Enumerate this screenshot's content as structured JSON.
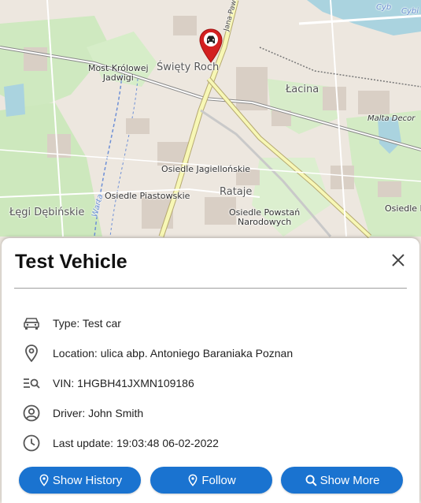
{
  "map": {
    "labels": {
      "most": "Most Królowej\nJadwigi",
      "swiety": "Święty Roch",
      "lacina": "Łacina",
      "malta": "Malta Decor",
      "jagiellonskie": "Osiedle Jagiellońskie",
      "piastowskie": "Osiedle Piastowskie",
      "rataje": "Rataje",
      "powstan": "Osiedle Powstań\nNarodowych",
      "legi": "Łęgi Dębińskie",
      "lech": "Osiedle L",
      "warta": "Warta",
      "jana": "Jana Pawła",
      "cyb": "Cyb",
      "cybi": "Cybi"
    }
  },
  "details": {
    "title": "Test Vehicle",
    "type": "Type: Test car",
    "location": "Location: ulica abp. Antoniego Baraniaka Poznan",
    "vin": "VIN: 1HGBH41JXMN109186",
    "driver": "Driver: John Smith",
    "last_update": "Last update: 19:03:48 06-02-2022"
  },
  "buttons": {
    "history": "Show History",
    "follow": "Follow",
    "more": "Show More"
  },
  "colors": {
    "accent": "#1a73d0",
    "pin": "#d32020"
  },
  "icons": {
    "pin": "car-marker-icon",
    "close": "close-icon",
    "type": "car-icon",
    "location": "location-pin-icon",
    "vin": "search-list-icon",
    "driver": "user-circle-icon",
    "last_update": "clock-icon"
  }
}
